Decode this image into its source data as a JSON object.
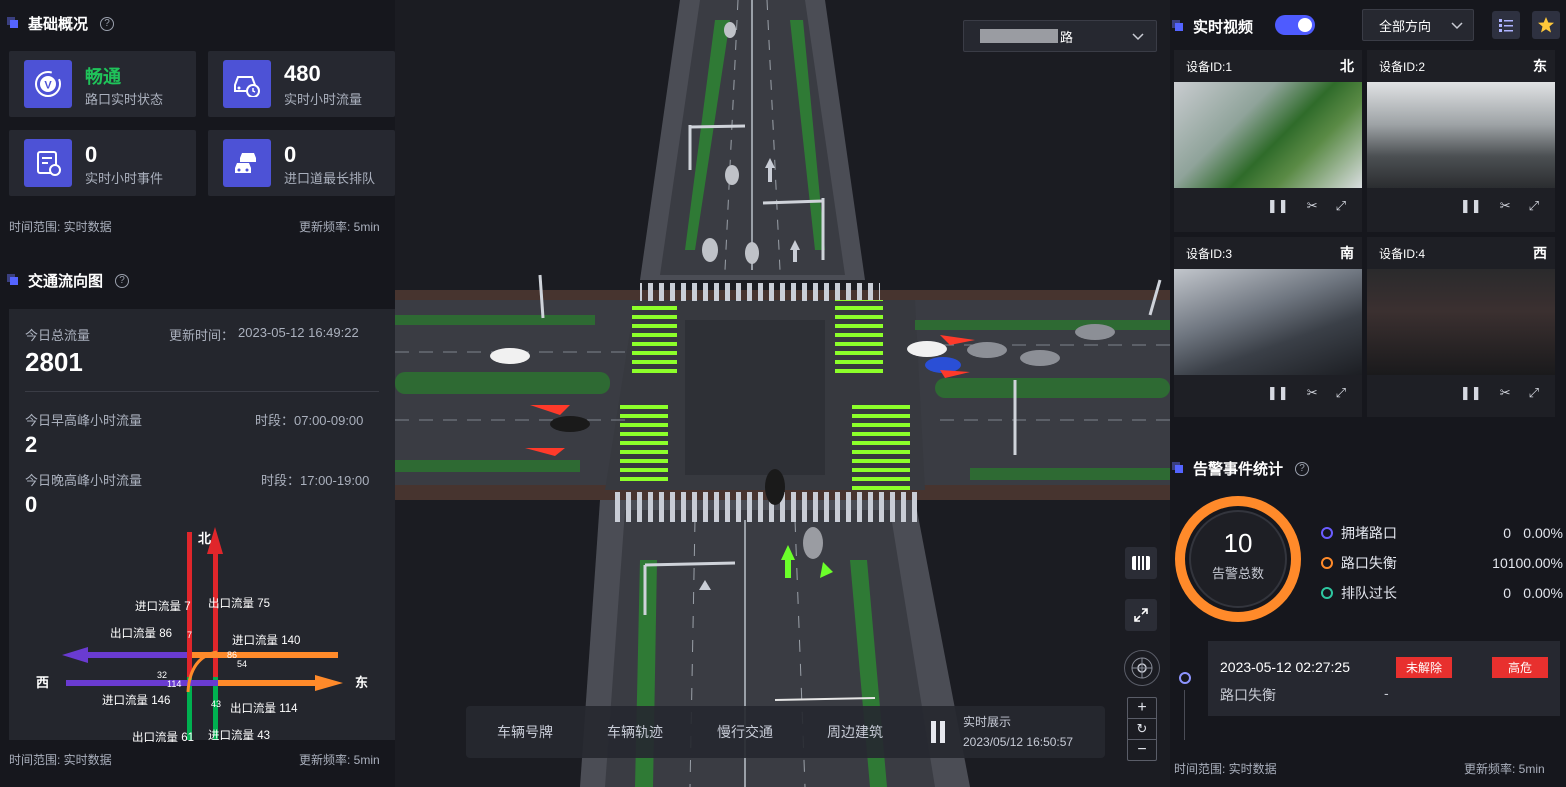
{
  "overview": {
    "title": "基础概况",
    "help": "?",
    "cards": [
      {
        "value": "畅通",
        "label": "路口实时状态"
      },
      {
        "value": "480",
        "label": "实时小时流量"
      },
      {
        "value": "0",
        "label": "实时小时事件"
      },
      {
        "value": "0",
        "label": "进口道最长排队"
      }
    ],
    "time_range": "时间范围: 实时数据",
    "refresh": "更新频率: 5min"
  },
  "flow": {
    "title": "交通流向图",
    "help": "?",
    "total_label": "今日总流量",
    "total_value": "2801",
    "updated_label": "更新时间：",
    "updated_value": "2023-05-12 16:49:22",
    "am_label": "今日早高峰小时流量",
    "am_value": "2",
    "am_period": "时段：07:00-09:00",
    "pm_label": "今日晚高峰小时流量",
    "pm_value": "0",
    "pm_period": "时段：17:00-19:00",
    "diagram": {
      "north": "北",
      "east": "东",
      "west": "西",
      "n_in": "进口流量 7",
      "n_out": "出口流量 75",
      "w_out": "出口流量 86",
      "e_in": "进口流量 140",
      "w_in": "进口流量 146",
      "e_out": "出口流量 114",
      "s_out": "出口流量 61",
      "s_in": "进口流量 43",
      "n7": "7",
      "n86": "86",
      "n54": "54",
      "n32": "32",
      "n114": "114",
      "n43": "43"
    },
    "time_range": "时间范围: 实时数据",
    "refresh": "更新频率: 5min"
  },
  "road_select": {
    "value": "路"
  },
  "video": {
    "title": "实时视频",
    "direction_select": "全部方向",
    "cams": [
      {
        "id": "设备ID:1",
        "dir": "北"
      },
      {
        "id": "设备ID:2",
        "dir": "东"
      },
      {
        "id": "设备ID:3",
        "dir": "南"
      },
      {
        "id": "设备ID:4",
        "dir": "西"
      }
    ]
  },
  "alarm": {
    "title": "告警事件统计",
    "help": "?",
    "total": "10",
    "total_label": "告警总数",
    "items": [
      {
        "name": "拥堵路口",
        "count": "0",
        "pct": "0.00%",
        "color": "#6a5cff"
      },
      {
        "name": "路口失衡",
        "count": "10",
        "pct": "100.00%",
        "color": "#ff8a2a"
      },
      {
        "name": "排队过长",
        "count": "0",
        "pct": "0.00%",
        "color": "#2ec7a0"
      }
    ],
    "event": {
      "time": "2023-05-12 02:27:25",
      "type": "路口失衡",
      "detail": "-",
      "status": "未解除",
      "level": "高危"
    },
    "time_range": "时间范围: 实时数据",
    "refresh": "更新频率: 5min"
  },
  "bottom": {
    "tabs": [
      "车辆号牌",
      "车辆轨迹",
      "慢行交通",
      "周边建筑"
    ],
    "live_label": "实时展示",
    "live_time": "2023/05/12 16:50:57"
  },
  "colors": {
    "accent": "#4e5bff",
    "orange": "#ff8a2a",
    "red": "#e8302e",
    "green": "#00b050"
  }
}
